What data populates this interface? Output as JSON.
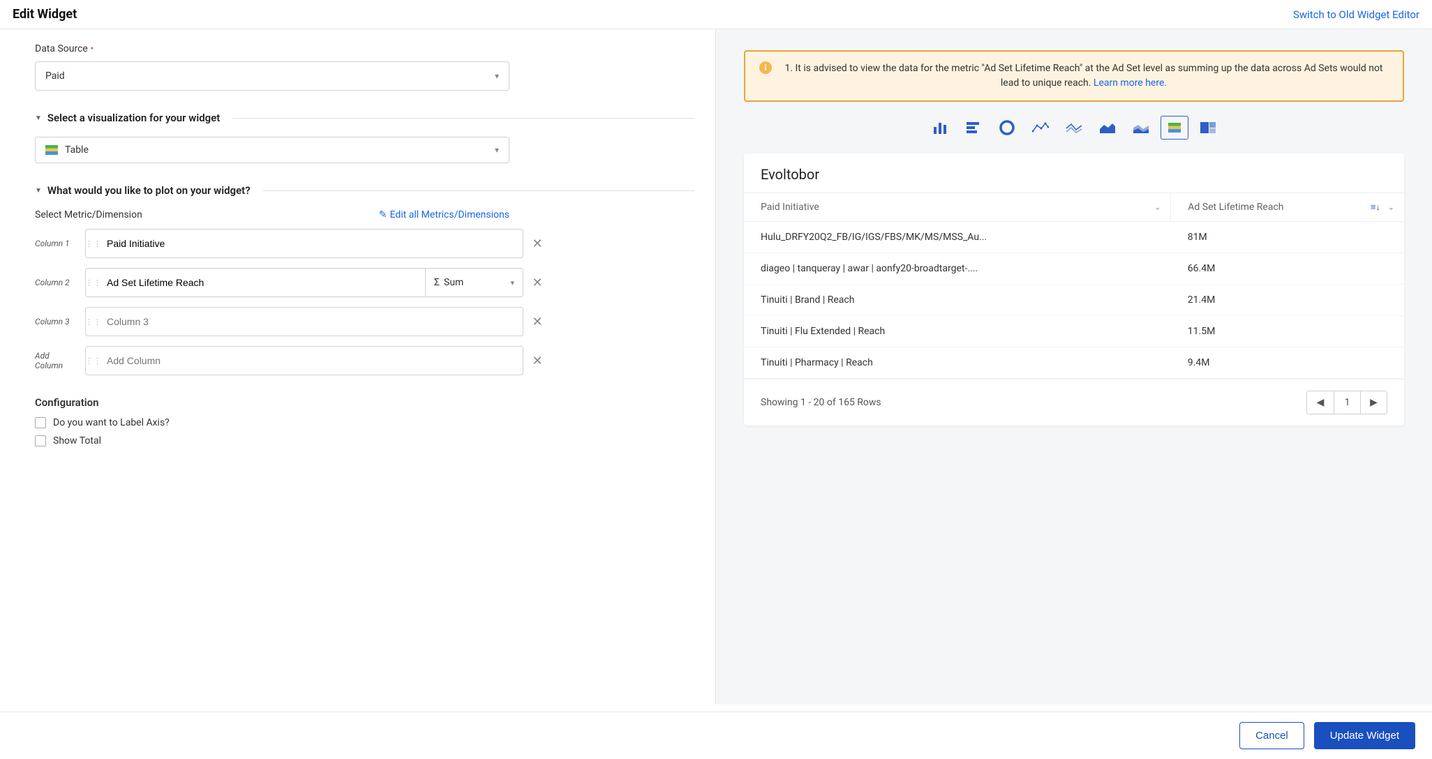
{
  "header": {
    "title": "Edit Widget",
    "switch_link": "Switch to Old Widget Editor"
  },
  "data_source": {
    "label": "Data Source",
    "value": "Paid"
  },
  "visualization": {
    "section_title": "Select a visualization for your widget",
    "value": "Table"
  },
  "plot": {
    "section_title": "What would you like to plot on your widget?",
    "select_label": "Select Metric/Dimension",
    "edit_all": "Edit all Metrics/Dimensions",
    "columns": [
      {
        "label": "Column 1",
        "value": "Paid Initiative",
        "agg": null
      },
      {
        "label": "Column 2",
        "value": "Ad Set Lifetime Reach",
        "agg": "Sum"
      },
      {
        "label": "Column 3",
        "value": "",
        "placeholder": "Column 3",
        "agg": null
      },
      {
        "label": "Add Column",
        "value": "",
        "placeholder": "Add Column",
        "agg": null
      }
    ]
  },
  "configuration": {
    "title": "Configuration",
    "label_axis": "Do you want to Label Axis?",
    "show_total": "Show Total"
  },
  "alert": {
    "text": "1. It is advised to view the data for the metric \"Ad Set Lifetime Reach\" at the Ad Set level as summing up the data across Ad Sets would not lead to unique reach. ",
    "link": "Learn more here."
  },
  "chart_types": [
    "bar",
    "horizontal-bar",
    "donut",
    "line",
    "multi-line",
    "area",
    "stacked-area",
    "table",
    "treemap"
  ],
  "chart_data": {
    "type": "table",
    "title": "Evoltobor",
    "columns": [
      "Paid Initiative",
      "Ad Set Lifetime Reach"
    ],
    "rows": [
      {
        "initiative": "Hulu_DRFY20Q2_FB/IG/IGS/FBS/MK/MS/MSS_Au...",
        "reach": "81M"
      },
      {
        "initiative": "diageo | tanqueray | awar | aonfy20-broadtarget-....",
        "reach": "66.4M"
      },
      {
        "initiative": "Tinuiti | Brand | Reach",
        "reach": "21.4M"
      },
      {
        "initiative": "Tinuiti | Flu Extended | Reach",
        "reach": "11.5M"
      },
      {
        "initiative": "Tinuiti | Pharmacy | Reach",
        "reach": "9.4M"
      }
    ],
    "footer": "Showing 1 - 20 of 165 Rows",
    "page": "1"
  },
  "footer_buttons": {
    "cancel": "Cancel",
    "update": "Update Widget"
  }
}
